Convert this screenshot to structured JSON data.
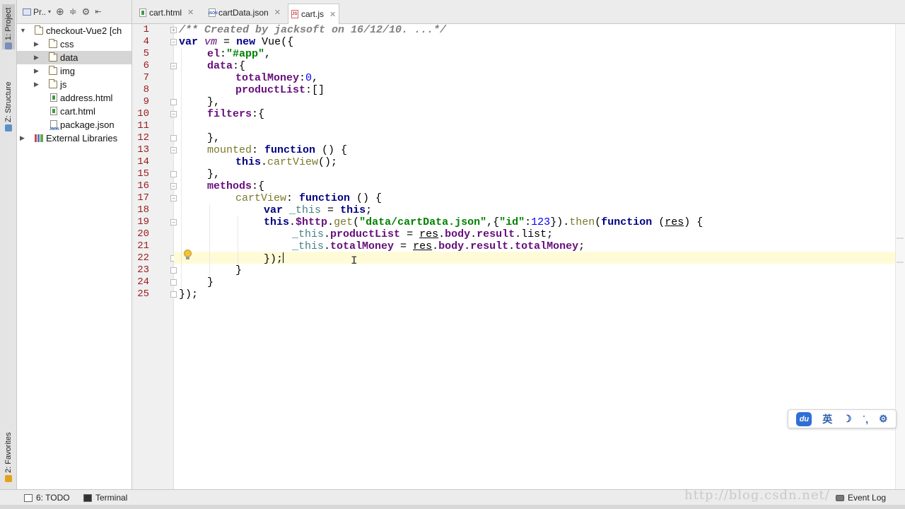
{
  "left_strip": {
    "project_tab": "1: Project",
    "structure_tab": "Z: Structure",
    "favorites_tab": "2: Favorites"
  },
  "project_panel": {
    "toolbar_label": "Pr..",
    "tree": [
      {
        "label": "checkout-Vue2 [ch",
        "kind": "project",
        "expanded": true
      },
      {
        "label": "css",
        "kind": "folder"
      },
      {
        "label": "data",
        "kind": "folder",
        "selected": true
      },
      {
        "label": "img",
        "kind": "folder"
      },
      {
        "label": "js",
        "kind": "folder"
      },
      {
        "label": "address.html",
        "kind": "html"
      },
      {
        "label": "cart.html",
        "kind": "html"
      },
      {
        "label": "package.json",
        "kind": "json"
      },
      {
        "label": "External Libraries",
        "kind": "library"
      }
    ]
  },
  "tabs": [
    {
      "label": "cart.html",
      "icon": "html-file-icon",
      "active": false
    },
    {
      "label": "cartData.json",
      "icon": "json-file-icon",
      "active": false
    },
    {
      "label": "cart.js",
      "icon": "js-file-icon",
      "active": true
    }
  ],
  "editor": {
    "line_numbers": [
      "1",
      "4",
      "5",
      "6",
      "7",
      "8",
      "9",
      "10",
      "11",
      "12",
      "13",
      "14",
      "15",
      "16",
      "17",
      "18",
      "19",
      "20",
      "21",
      "22",
      "23",
      "24",
      "25"
    ],
    "current_line": "22",
    "code_tokens": {
      "l1": "/** Created by jacksoft on 16/12/10. ...*/",
      "l4a": "var",
      "l4b": " ",
      "l4c": "vm",
      "l4d": " = ",
      "l4e": "new",
      "l4f": " Vue({",
      "l5a": "el",
      "l5b": ":",
      "l5c": "\"#app\"",
      "l5d": ",",
      "l6a": "data",
      "l6b": ":{",
      "l7a": "totalMoney",
      "l7b": ":",
      "l7c": "0",
      "l7d": ",",
      "l8a": "productList",
      "l8b": ":[]",
      "l9": "},",
      "l10a": "filters",
      "l10b": ":{",
      "l12": "},",
      "l13a": "mounted",
      "l13b": ": ",
      "l13c": "function",
      "l13d": " () {",
      "l14a": "this",
      "l14b": ".",
      "l14c": "cartView",
      "l14d": "();",
      "l15": "},",
      "l16a": "methods",
      "l16b": ":{",
      "l17a": "cartView",
      "l17b": ": ",
      "l17c": "function",
      "l17d": " () {",
      "l18a": "var",
      "l18b": " ",
      "l18c": "_this",
      "l18d": " = ",
      "l18e": "this",
      "l18f": ";",
      "l19a": "this",
      "l19b": ".",
      "l19c": "$http",
      "l19d": ".",
      "l19e": "get",
      "l19f": "(",
      "l19g": "\"data/cartData.json\"",
      "l19h": ",{",
      "l19i": "\"id\"",
      "l19j": ":",
      "l19k": "123",
      "l19l": "}).",
      "l19m": "then",
      "l19n": "(",
      "l19o": "function",
      "l19p": " (",
      "l19q": "res",
      "l19r": ") {",
      "l20a": "_this",
      "l20b": ".",
      "l20c": "productList",
      "l20d": " = ",
      "l20e": "res",
      "l20f": ".",
      "l20g": "body",
      "l20h": ".",
      "l20i": "result",
      "l20j": ".list;",
      "l21a": "_this",
      "l21b": ".",
      "l21c": "totalMoney",
      "l21d": " = ",
      "l21e": "res",
      "l21f": ".",
      "l21g": "body",
      "l21h": ".",
      "l21i": "result",
      "l21j": ".",
      "l21k": "totalMoney",
      "l21l": ";",
      "l22": "});",
      "l23": "}",
      "l24": "}",
      "l25": "});"
    }
  },
  "ime_bar": {
    "logo": "du",
    "lang": "英",
    "moon": "☽",
    "punct": "˙,",
    "settings": "⚙"
  },
  "bottom": {
    "todo": "6: TODO",
    "terminal": "Terminal",
    "event_log": "Event Log",
    "watermark": "http://blog.csdn.net/"
  },
  "colors": {
    "keyword": "#000080",
    "string": "#008000",
    "number": "#0000ff",
    "property": "#660e7a",
    "comment": "#808080",
    "line_number": "#9b1c1c",
    "current_line_bg": "#fffbd6"
  }
}
